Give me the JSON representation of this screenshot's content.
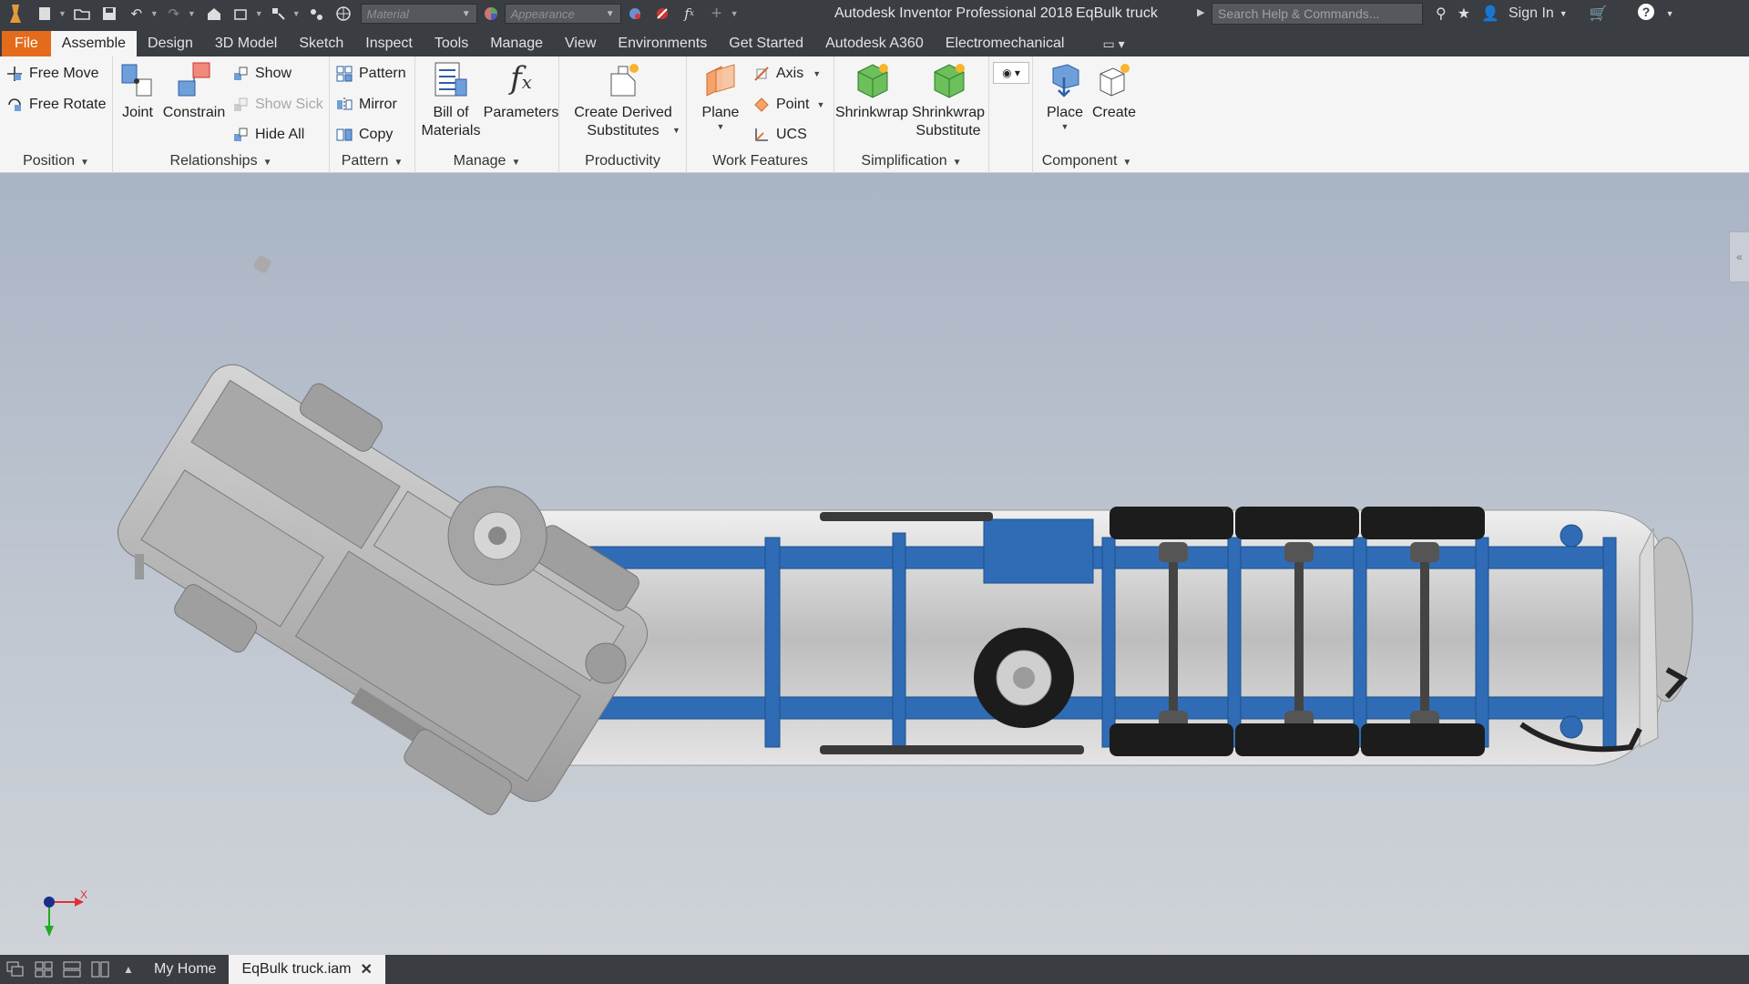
{
  "titlebar": {
    "material_placeholder": "Material",
    "appearance_placeholder": "Appearance",
    "app_title": "Autodesk Inventor Professional 2018",
    "document_title": "EqBulk truck",
    "search_placeholder": "Search Help & Commands...",
    "sign_in": "Sign In"
  },
  "tabs": [
    "File",
    "Assemble",
    "Design",
    "3D Model",
    "Sketch",
    "Inspect",
    "Tools",
    "Manage",
    "View",
    "Environments",
    "Get Started",
    "Autodesk A360",
    "Electromechanical"
  ],
  "active_tab": "Assemble",
  "ribbon": {
    "position": {
      "title": "Position",
      "free_move": "Free Move",
      "free_rotate": "Free Rotate"
    },
    "relationships": {
      "title": "Relationships",
      "joint": "Joint",
      "constrain": "Constrain",
      "show": "Show",
      "show_sick": "Show Sick",
      "hide_all": "Hide All"
    },
    "pattern": {
      "title": "Pattern",
      "pattern": "Pattern",
      "mirror": "Mirror",
      "copy": "Copy"
    },
    "manage": {
      "title": "Manage",
      "bom_line1": "Bill of",
      "bom_line2": "Materials",
      "parameters": "Parameters"
    },
    "productivity": {
      "title": "Productivity",
      "line1": "Create Derived",
      "line2": "Substitutes"
    },
    "work_features": {
      "title": "Work Features",
      "plane": "Plane",
      "axis": "Axis",
      "point": "Point",
      "ucs": "UCS"
    },
    "simplification": {
      "title": "Simplification",
      "shrinkwrap": "Shrinkwrap",
      "sub_line1": "Shrinkwrap",
      "sub_line2": "Substitute"
    },
    "component": {
      "title": "Component",
      "place": "Place",
      "create": "Create"
    }
  },
  "viewport": {
    "triad_x": "X",
    "colors": {
      "frame_blue": "#2f6cb5",
      "body_gray": "#c8c8c8",
      "tire_black": "#1c1c1c"
    }
  },
  "docbar": {
    "my_home": "My Home",
    "active_doc": "EqBulk truck.iam"
  },
  "colors": {
    "accent_file_tab": "#e46b1b",
    "chrome_dark": "#3a3d42",
    "ribbon_bg": "#f5f5f5"
  }
}
